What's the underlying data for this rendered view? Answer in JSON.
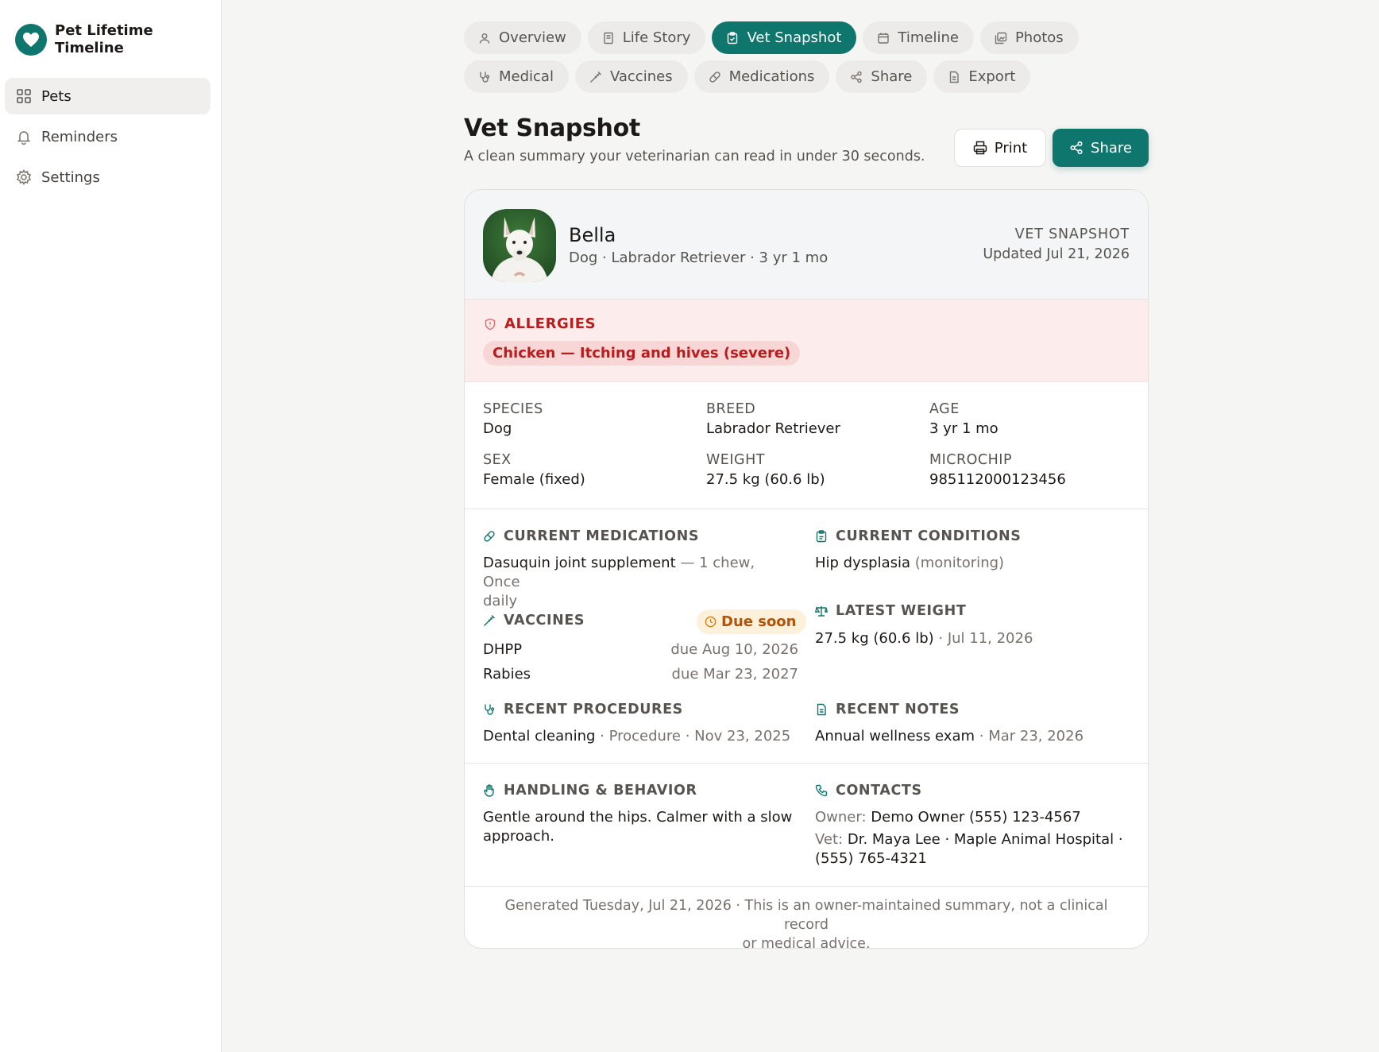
{
  "app": {
    "title_line1": "Pet Lifetime",
    "title_line2": "Timeline"
  },
  "sidebar": {
    "items": [
      {
        "label": "Pets",
        "icon": "grid-icon",
        "active": true
      },
      {
        "label": "Reminders",
        "icon": "bell-icon"
      },
      {
        "label": "Settings",
        "icon": "gear-icon"
      }
    ]
  },
  "tabs": [
    {
      "label": "Overview",
      "icon": "user-icon"
    },
    {
      "label": "Life Story",
      "icon": "book-icon"
    },
    {
      "label": "Vet Snapshot",
      "icon": "clipboard-icon",
      "active": true
    },
    {
      "label": "Timeline",
      "icon": "calendar-icon"
    },
    {
      "label": "Photos",
      "icon": "images-icon"
    },
    {
      "label": "Medical",
      "icon": "stethoscope-icon"
    },
    {
      "label": "Vaccines",
      "icon": "syringe-icon"
    },
    {
      "label": "Medications",
      "icon": "pill-icon"
    },
    {
      "label": "Share",
      "icon": "share-icon"
    },
    {
      "label": "Export",
      "icon": "file-icon"
    }
  ],
  "page": {
    "title": "Vet Snapshot",
    "subtitle": "A clean summary your veterinarian can read in under 30 seconds.",
    "print_label": "Print",
    "share_label": "Share"
  },
  "pet": {
    "name": "Bella",
    "meta": "Dog · Labrador Retriever · 3 yr 1 mo",
    "snapshot_label": "VET SNAPSHOT",
    "updated": "Updated Jul 21, 2026"
  },
  "allergies": {
    "title": "ALLERGIES",
    "items": [
      "Chicken — Itching and hives (severe)"
    ]
  },
  "facts": {
    "species": {
      "label": "SPECIES",
      "value": "Dog"
    },
    "breed": {
      "label": "BREED",
      "value": "Labrador Retriever"
    },
    "age": {
      "label": "AGE",
      "value": "3 yr 1 mo"
    },
    "sex": {
      "label": "SEX",
      "value": "Female (fixed)"
    },
    "weight": {
      "label": "WEIGHT",
      "value": "27.5 kg (60.6 lb)"
    },
    "microchip": {
      "label": "MICROCHIP",
      "value": "985112000123456"
    }
  },
  "medications": {
    "title": "CURRENT MEDICATIONS",
    "name": "Dasuquin joint supplement",
    "detail": " — 1 chew, Once",
    "detail2": "daily"
  },
  "conditions": {
    "title": "CURRENT CONDITIONS",
    "name": "Hip dysplasia",
    "status": " (monitoring)"
  },
  "vaccines": {
    "title": "VACCINES",
    "badge": "Due soon",
    "items": [
      {
        "name": "DHPP",
        "due": "due Aug 10, 2026"
      },
      {
        "name": "Rabies",
        "due": "due Mar 23, 2027"
      }
    ]
  },
  "latest_weight": {
    "title": "LATEST WEIGHT",
    "value": "27.5 kg (60.6 lb)",
    "date": " · Jul 11, 2026"
  },
  "procedures": {
    "title": "RECENT PROCEDURES",
    "name": "Dental cleaning",
    "detail": " · Procedure · Nov 23, 2025"
  },
  "notes": {
    "title": "RECENT NOTES",
    "name": "Annual wellness exam",
    "date": " · Mar 23, 2026"
  },
  "handling": {
    "title": "HANDLING & BEHAVIOR",
    "text1": "Gentle around the hips. Calmer with a slow",
    "text2": "approach."
  },
  "contacts": {
    "title": "CONTACTS",
    "owner_label": "Owner:",
    "owner": " Demo Owner (555) 123-4567",
    "vet_label": "Vet:",
    "vet": " Dr. Maya Lee · Maple Animal Hospital ·",
    "vet2": "(555) 765-4321"
  },
  "footer": {
    "line1": "Generated Tuesday, Jul 21, 2026 · This is an owner-maintained summary, not a clinical record",
    "line2": "or medical advice."
  },
  "colors": {
    "accent": "#0f766e",
    "allergy_bg": "#fdecec",
    "allergy_text": "#b91c1c",
    "due_bg": "#fdf1dc",
    "due_text": "#b45309"
  }
}
